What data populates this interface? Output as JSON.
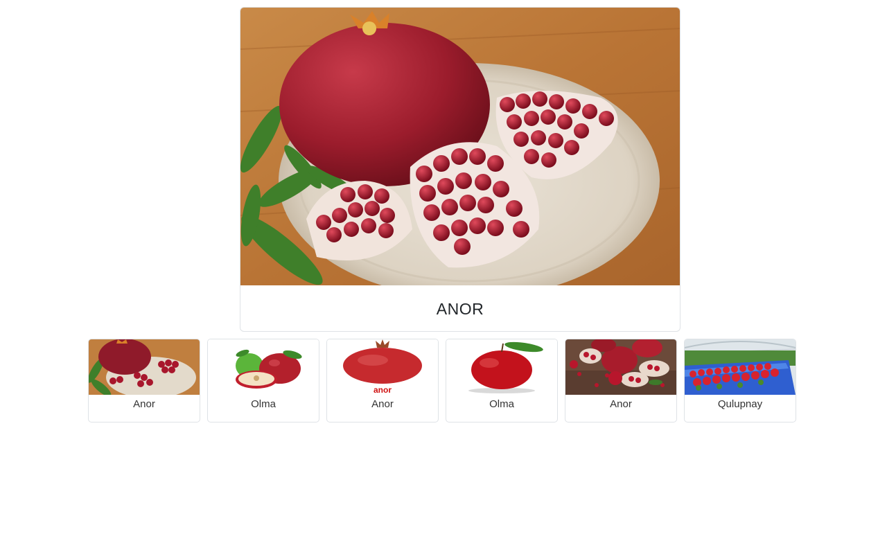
{
  "main": {
    "title": "ANOR",
    "image": "pomegranate-on-plate-image"
  },
  "thumbnails": [
    {
      "label": "Anor",
      "image": "pomegranate-on-plate-image"
    },
    {
      "label": "Olma",
      "image": "apples-image"
    },
    {
      "label": "Anor",
      "image": "pomegranate-image",
      "image_text": "anor"
    },
    {
      "label": "Olma",
      "image": "red-apple-image"
    },
    {
      "label": "Anor",
      "image": "pomegranates-on-table-image"
    },
    {
      "label": "Qulupnay",
      "image": "strawberry-greenhouse-image"
    }
  ]
}
